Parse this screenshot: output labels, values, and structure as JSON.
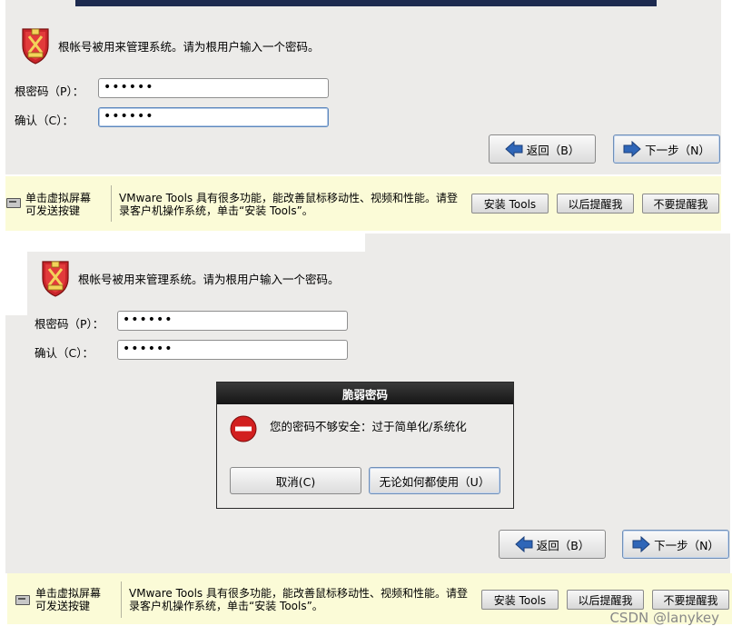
{
  "system_message": "根帐号被用来管理系统。请为根用户输入一个密码。",
  "form": {
    "root_password_label": "根密码（P）：",
    "confirm_label": "确认（C）：",
    "root_password_value": "••••••",
    "confirm_value": "••••••"
  },
  "nav": {
    "back_label": "返回（B）",
    "next_label": "下一步（N）"
  },
  "vmware_bar": {
    "hint": [
      "单击虚拟屏幕",
      "可发送按键"
    ],
    "text": [
      "VMware Tools 具有很多功能，能改善鼠标移动性、视频和性能。请登",
      "录客户机操作系统，单击“安装 Tools”。"
    ],
    "install_label": "安装 Tools",
    "later_label": "以后提醒我",
    "never_label": "不要提醒我"
  },
  "dialog": {
    "title": "脆弱密码",
    "message": "您的密码不够安全：过于简单化/系统化",
    "cancel_label": "取消(C)",
    "use_anyway_label": "无论如何都使用（U）"
  },
  "watermark": "CSDN @lanykey",
  "colors": {
    "title_bar": "#1d2a4f",
    "panel_bg": "#ecebe9",
    "info_bar_bg": "#fbfbd7",
    "dialog_title_bg": "#151515",
    "error_red": "#d21f1f",
    "arrow_blue": "#2f66b8"
  },
  "icons": {
    "shield": "shield-icon",
    "back": "arrow-left-icon",
    "next": "arrow-right-icon",
    "error": "error-minus-icon",
    "vm_keyboard": "keyboard-icon"
  }
}
